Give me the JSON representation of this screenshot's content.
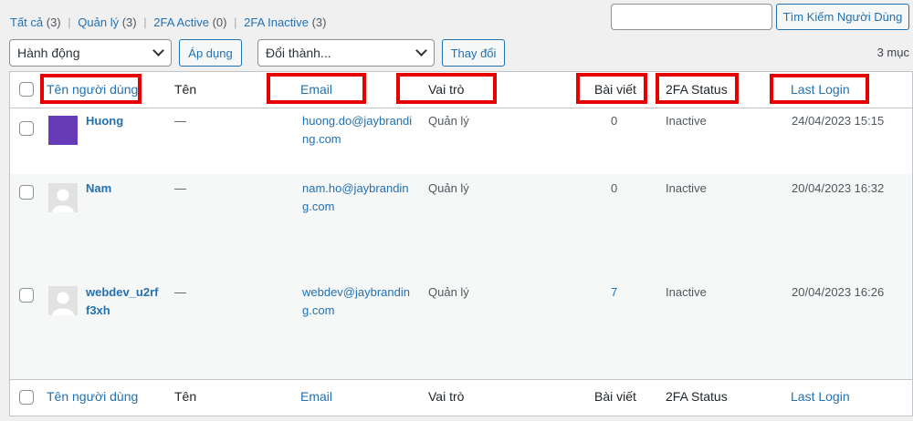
{
  "filters": {
    "all": {
      "label": "Tất cả",
      "count": "(3)"
    },
    "admin": {
      "label": "Quản lý",
      "count": "(3)"
    },
    "active": {
      "label": "2FA Active",
      "count": "(0)"
    },
    "inactive": {
      "label": "2FA Inactive",
      "count": "(3)"
    },
    "separator": "|"
  },
  "search": {
    "value": "",
    "button_label": "Tìm Kiếm Người Dùng"
  },
  "bulk": {
    "selected": "Hành động",
    "apply_label": "Áp dụng"
  },
  "role_change": {
    "selected": "Đổi thành...",
    "change_label": "Thay đổi"
  },
  "item_count": "3 mục",
  "columns": {
    "username": "Tên người dùng",
    "name": "Tên",
    "email": "Email",
    "role": "Vai trò",
    "posts": "Bài viết",
    "twofa": "2FA Status",
    "last_login": "Last Login"
  },
  "users": [
    {
      "username": "Huong",
      "name": "—",
      "email_line1": "huong.do@jaybrandi",
      "email_line2": "ng.com",
      "role": "Quản lý",
      "posts": "0",
      "twofa": "Inactive",
      "last_login": "24/04/2023 15:15",
      "avatar": "purple-avatar"
    },
    {
      "username": "Nam",
      "name": "—",
      "email_line1": "nam.ho@jaybrandin",
      "email_line2": "g.com",
      "role": "Quản lý",
      "posts": "0",
      "twofa": "Inactive",
      "last_login": "20/04/2023 16:32",
      "avatar": "default-avatar"
    },
    {
      "username_line1": "webdev_u2rf",
      "username_line2": "f3xh",
      "name": "—",
      "email_line1": "webdev@jaybrandin",
      "email_line2": "g.com",
      "role": "Quản lý",
      "posts": "7",
      "twofa": "Inactive",
      "last_login": "20/04/2023 16:26",
      "avatar": "default-avatar"
    }
  ],
  "colors": {
    "link": "#2271b1",
    "highlight": "#e60000",
    "avatar_purple": "#673ab7"
  }
}
